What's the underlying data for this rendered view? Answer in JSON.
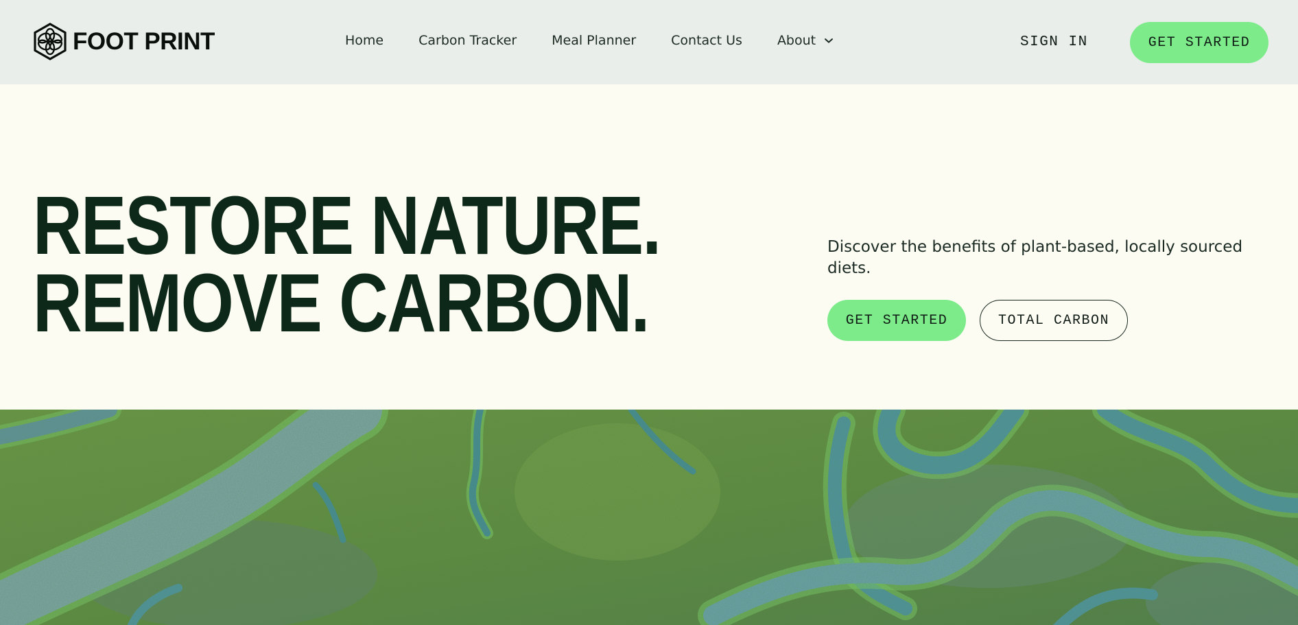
{
  "brand": {
    "name": "FOOT PRINT",
    "icon": "hexagon-flower-logo-icon"
  },
  "nav": {
    "items": [
      {
        "label": "Home"
      },
      {
        "label": "Carbon Tracker"
      },
      {
        "label": "Meal Planner"
      },
      {
        "label": "Contact Us"
      },
      {
        "label": "About",
        "icon": "chevron-down-icon"
      }
    ]
  },
  "header": {
    "signin_label": "SIGN IN",
    "cta_label": "GET STARTED"
  },
  "hero": {
    "headline_line1": "RESTORE NATURE.",
    "headline_line2": "REMOVE CARBON.",
    "subtext": "Discover the benefits of plant-based, locally sourced diets.",
    "primary_cta": "GET STARTED",
    "secondary_cta": "TOTAL CARBON"
  },
  "colors": {
    "header_bg": "#e9eeea",
    "page_bg": "#fdfcf3",
    "accent_green": "#7deb8a",
    "headline": "#0d2818"
  }
}
